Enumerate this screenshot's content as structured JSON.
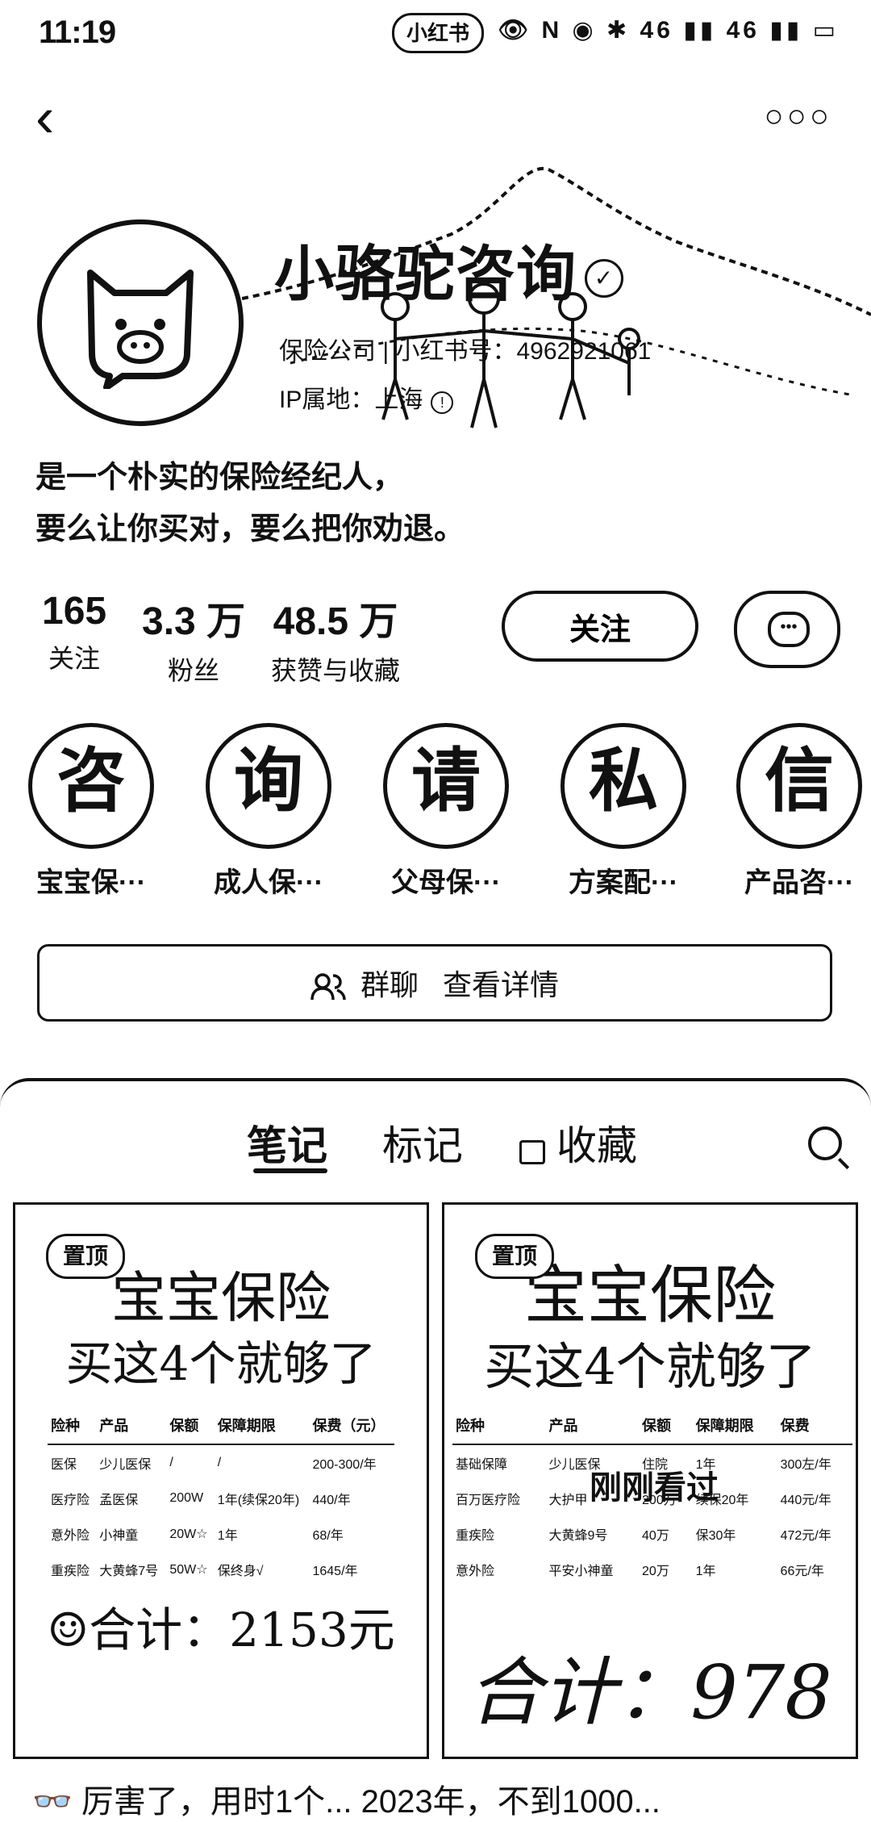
{
  "status_bar": {
    "time": "11:19",
    "center_pill": "小红书",
    "icons_text": "👁 N ◉ ✱ 46 ▮▮ 46 ▮▮ ▭"
  },
  "profile": {
    "name": "小骆驼咨询",
    "company_line": "保险公司 | 小红书号：4962921061",
    "ip_line": "IP属地：上海",
    "bio_line1": "是一个朴实的保险经纪人，",
    "bio_line2": "要么让你买对，要么把你劝退。"
  },
  "stats": [
    {
      "value": "165",
      "label": "关注"
    },
    {
      "value": "3.3 万",
      "label": "粉丝"
    },
    {
      "value": "48.5 万",
      "label": "获赞与收藏"
    }
  ],
  "actions": {
    "follow_label": "关注"
  },
  "services": [
    {
      "glyph": "咨",
      "label": "宝宝保···"
    },
    {
      "glyph": "询",
      "label": "成人保···"
    },
    {
      "glyph": "请",
      "label": "父母保···"
    },
    {
      "glyph": "私",
      "label": "方案配···"
    },
    {
      "glyph": "信",
      "label": "产品咨···"
    }
  ],
  "group": {
    "label": "群聊",
    "link": "查看详情"
  },
  "tabs": [
    {
      "label": "笔记",
      "active": true
    },
    {
      "label": "标记",
      "active": false
    },
    {
      "label": "收藏",
      "active": false
    }
  ],
  "notes": [
    {
      "pin": "置顶",
      "title1": "宝宝保险",
      "title2": "买这4个就够了",
      "table_header": [
        "险种",
        "产品",
        "保额",
        "保障期限",
        "保费（元）"
      ],
      "rows": [
        [
          "医保",
          "少儿医保",
          "/",
          "/",
          "200-300/年"
        ],
        [
          "医疗险",
          "孟医保",
          "200W",
          "1年(续保20年)",
          "440/年"
        ],
        [
          "意外险",
          "小神童",
          "20W☆",
          "1年",
          "68/年"
        ],
        [
          "重疾险",
          "大黄蜂7号",
          "50W☆",
          "保终身√",
          "1645/年"
        ]
      ],
      "total": "☺合计：2153元"
    },
    {
      "pin": "置顶",
      "title1": "宝宝保险",
      "title2": "买这4个就够了",
      "table_header": [
        "险种",
        "产品",
        "保额",
        "保障期限",
        "保费"
      ],
      "rows": [
        [
          "基础保障",
          "少儿医保",
          "住院",
          "1年",
          "300左/年"
        ],
        [
          "百万医疗险",
          "大护甲",
          "200万",
          "续保20年",
          "440元/年"
        ],
        [
          "重疾险",
          "大黄蜂9号",
          "40万",
          "保30年",
          "472元/年"
        ],
        [
          "意外险",
          "平安小神童",
          "20万",
          "1年",
          "66元/年"
        ]
      ],
      "seen": "刚刚看过",
      "total": "合计：978"
    }
  ],
  "bottom_text": "👓 厉害了，用时1个... 2023年，不到1000..."
}
